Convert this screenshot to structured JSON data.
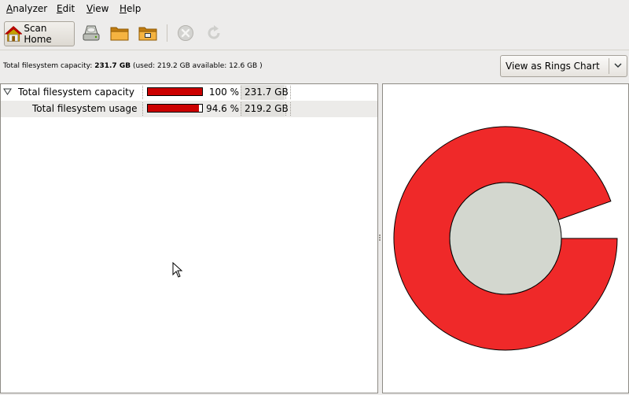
{
  "menu": {
    "items": [
      {
        "underline": "A",
        "rest": "nalyzer"
      },
      {
        "underline": "E",
        "rest": "dit"
      },
      {
        "underline": "V",
        "rest": "iew"
      },
      {
        "underline": "H",
        "rest": "elp"
      }
    ]
  },
  "toolbar": {
    "scan_home_label": "Scan Home",
    "icons": [
      "home-icon",
      "harddisk-icon",
      "folder-icon",
      "remote-folder-icon",
      "stop-icon",
      "refresh-icon"
    ]
  },
  "info": {
    "prefix": "Total filesystem capacity: ",
    "capacity": "231.7 GB",
    "used_prefix": " (used: ",
    "used": "219.2 GB",
    "available_prefix": " available: ",
    "available": "12.6 GB",
    "suffix": " )"
  },
  "view_selector": {
    "value": "View as Rings Chart"
  },
  "tree": {
    "rows": [
      {
        "name": "Total filesystem capacity",
        "percent": "100 %",
        "size": "231.7 GB",
        "fill": 1.0
      },
      {
        "name": "Total filesystem usage",
        "percent": "94.6 %",
        "size": "219.2 GB",
        "fill": 0.946
      }
    ]
  },
  "ring_chart": {
    "used_fraction": 0.946,
    "ring_color": "#ef2929",
    "center_color": "#d3d7cf"
  },
  "colors": {
    "usage_bar": "#cc0000"
  }
}
